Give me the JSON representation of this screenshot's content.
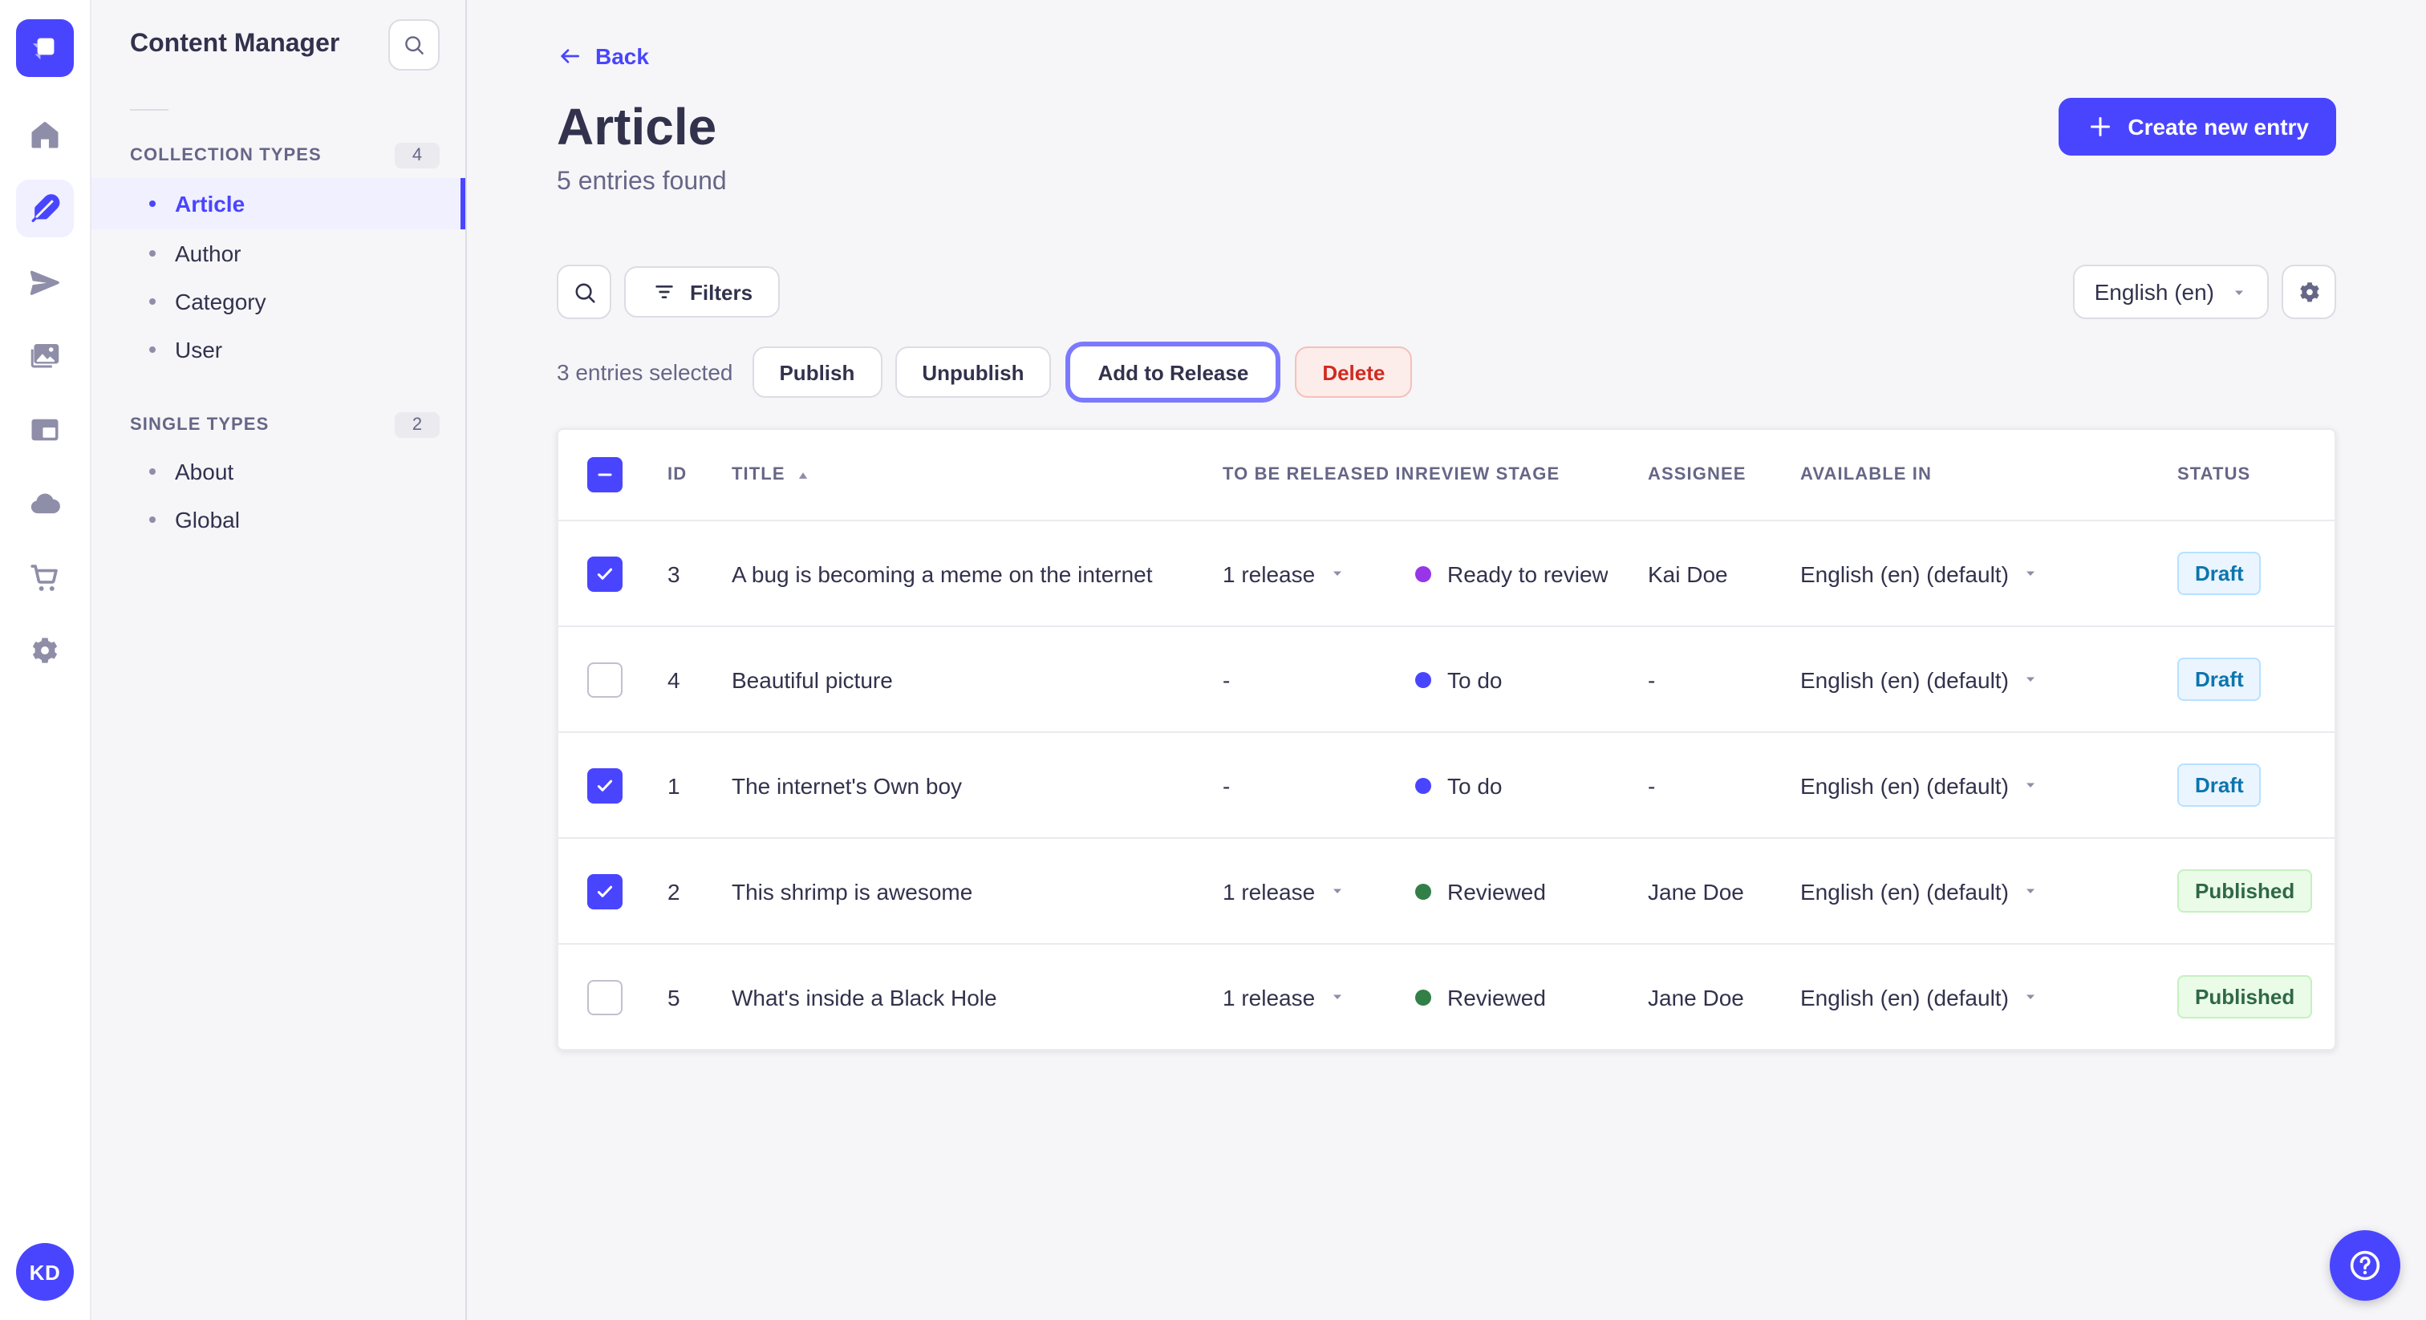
{
  "sidebar": {
    "title": "Content Manager",
    "sections": [
      {
        "label": "COLLECTION TYPES",
        "count": "4",
        "items": [
          {
            "label": "Article",
            "active": true
          },
          {
            "label": "Author",
            "active": false
          },
          {
            "label": "Category",
            "active": false
          },
          {
            "label": "User",
            "active": false
          }
        ]
      },
      {
        "label": "SINGLE TYPES",
        "count": "2",
        "items": [
          {
            "label": "About",
            "active": false
          },
          {
            "label": "Global",
            "active": false
          }
        ]
      }
    ]
  },
  "header": {
    "back_label": "Back",
    "title": "Article",
    "subtitle": "5 entries found",
    "create_button": "Create new entry"
  },
  "controls": {
    "filters_label": "Filters",
    "locale_value": "English (en)"
  },
  "selection": {
    "count_label": "3 entries selected",
    "publish_label": "Publish",
    "unpublish_label": "Unpublish",
    "add_to_release_label": "Add to Release",
    "delete_label": "Delete"
  },
  "table": {
    "headers": [
      "ID",
      "TITLE",
      "TO BE RELEASED IN",
      "REVIEW STAGE",
      "ASSIGNEE",
      "AVAILABLE IN",
      "STATUS"
    ],
    "sorted_column": "TITLE",
    "sort_direction": "asc",
    "rows": [
      {
        "checked": true,
        "id": "3",
        "title": "A bug is becoming a meme on the internet",
        "release": "1 release",
        "has_release": true,
        "review_stage": "Ready to review",
        "review_color": "#9736e8",
        "assignee": "Kai Doe",
        "available_in": "English (en) (default)",
        "status": "Draft"
      },
      {
        "checked": false,
        "id": "4",
        "title": "Beautiful picture",
        "release": "-",
        "has_release": false,
        "review_stage": "To do",
        "review_color": "#4945ff",
        "assignee": "-",
        "available_in": "English (en) (default)",
        "status": "Draft"
      },
      {
        "checked": true,
        "id": "1",
        "title": "The internet's Own boy",
        "release": "-",
        "has_release": false,
        "review_stage": "To do",
        "review_color": "#4945ff",
        "assignee": "-",
        "available_in": "English (en) (default)",
        "status": "Draft"
      },
      {
        "checked": true,
        "id": "2",
        "title": "This shrimp is awesome",
        "release": "1 release",
        "has_release": true,
        "review_stage": "Reviewed",
        "review_color": "#328048",
        "assignee": "Jane Doe",
        "available_in": "English (en) (default)",
        "status": "Published"
      },
      {
        "checked": false,
        "id": "5",
        "title": "What's inside a Black Hole",
        "release": "1 release",
        "has_release": true,
        "review_stage": "Reviewed",
        "review_color": "#328048",
        "assignee": "Jane Doe",
        "available_in": "English (en) (default)",
        "status": "Published"
      }
    ]
  },
  "avatar": {
    "initials": "KD"
  },
  "colors": {
    "primary": "#4945ff",
    "active_item_bg": "#f0f0ff",
    "focus_ring": "#7b79ff",
    "draft_bg": "#eaf5ff",
    "draft_text": "#0c75af",
    "published_bg": "#eafbe7",
    "published_text": "#2f6846",
    "delete_bg": "#fcecea",
    "delete_text": "#d02b20",
    "review_ready_to_review": "#9736e8",
    "review_to_do": "#4945ff",
    "review_reviewed": "#328048"
  },
  "icons": [
    "strapi-logo",
    "home",
    "content-manager-feather",
    "paper-plane",
    "media-library",
    "layout",
    "cloud",
    "marketplace-cart",
    "settings-gear",
    "search",
    "filter",
    "plus",
    "back-arrow",
    "sort-asc",
    "caret-down",
    "checkmark",
    "indeterminate-minus",
    "question-mark"
  ]
}
